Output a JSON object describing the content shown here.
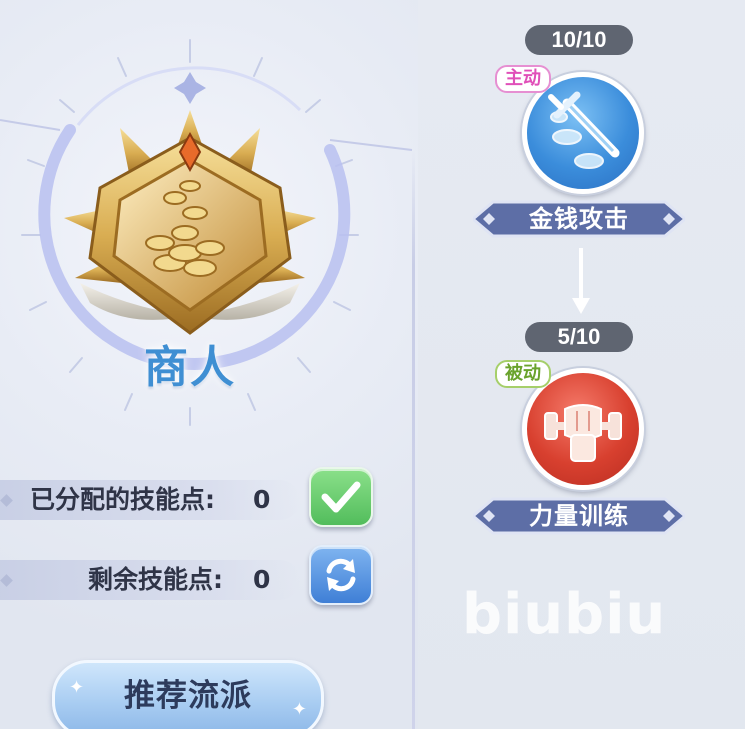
{
  "class_panel": {
    "class_name": "商人",
    "emblem_icon": "coin-pile-crest-icon"
  },
  "skill_points": {
    "allocated_label": "已分配的技能点:",
    "allocated_value": "0",
    "remaining_label": "剩余技能点:",
    "remaining_value": "0",
    "confirm_icon": "checkmark-icon",
    "reset_icon": "refresh-icon"
  },
  "recommend_button": {
    "label": "推荐流派"
  },
  "skills": [
    {
      "level": "10/10",
      "tag": "主动",
      "name": "金钱攻击",
      "icon": "sword-coins-icon",
      "orb_color": "#3b8ddb"
    },
    {
      "level": "5/10",
      "tag": "被动",
      "name": "力量训练",
      "icon": "fist-dumbbell-icon",
      "orb_color": "#d8402f"
    }
  ],
  "watermark": "biubiu",
  "colors": {
    "class_name": "#3f8fd3",
    "active_tag": "#e050b9",
    "passive_tag": "#6aa32c",
    "banner": "#5d6ea6"
  }
}
